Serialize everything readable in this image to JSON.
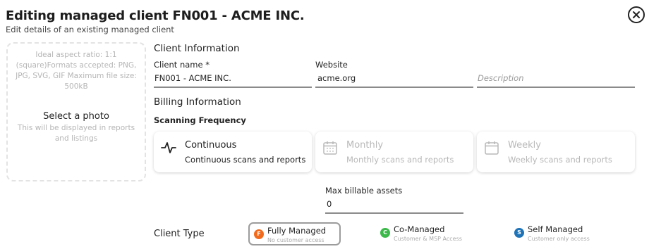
{
  "header": {
    "title": "Editing managed client FN001 - ACME INC.",
    "subtitle": "Edit details of an existing managed client",
    "close_icon": "close-circle-icon"
  },
  "photo": {
    "hint": "Ideal aspect ratio: 1:1 (square)Formats accepted: PNG, JPG, SVG, GIF Maximum file size: 500kB",
    "cta": "Select a photo",
    "subtext": "This will be displayed in reports and listings"
  },
  "client_info": {
    "heading": "Client Information",
    "name_label": "Client name *",
    "name_value": "FN001 - ACME INC.",
    "website_label": "Website",
    "website_value": "acme.org",
    "description_placeholder": "Description"
  },
  "billing": {
    "heading": "Billing Information",
    "scanning_label": "Scanning Frequency",
    "options": [
      {
        "title": "Continuous",
        "desc": "Continuous scans and reports",
        "icon": "pulse-icon",
        "enabled": true
      },
      {
        "title": "Monthly",
        "desc": "Monthly scans and reports",
        "icon": "calendar-icon",
        "enabled": false
      },
      {
        "title": "Weekly",
        "desc": "Weekly scans and reports",
        "icon": "calendar-icon",
        "enabled": false
      }
    ],
    "max_assets_label": "Max billable assets",
    "max_assets_value": "0"
  },
  "client_type": {
    "label": "Client Type",
    "options": [
      {
        "letter": "F",
        "name": "Fully Managed",
        "desc": "No customer access",
        "color": "#f26b1d",
        "selected": true
      },
      {
        "letter": "C",
        "name": "Co-Managed",
        "desc": "Customer & MSP Access",
        "color": "#3cb94a",
        "selected": false
      },
      {
        "letter": "S",
        "name": "Self Managed",
        "desc": "Customer only access",
        "color": "#1f73b7",
        "selected": false
      }
    ]
  }
}
